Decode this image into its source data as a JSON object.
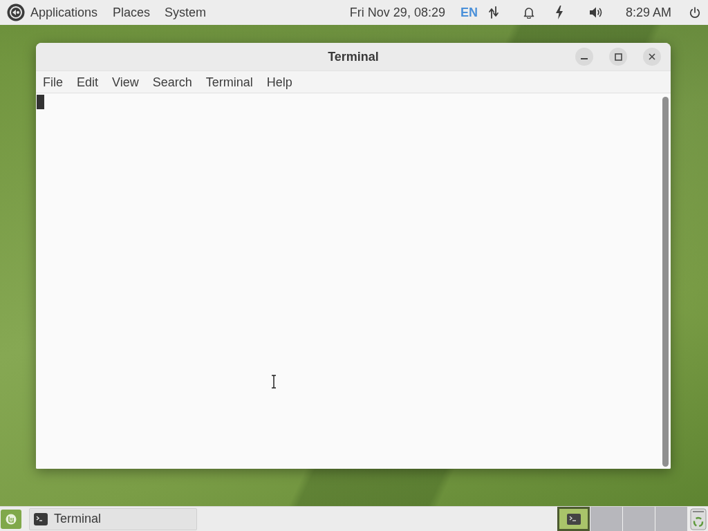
{
  "top_panel": {
    "menus": [
      "Applications",
      "Places",
      "System"
    ],
    "date": "Fri Nov 29, 08:29",
    "keyboard_layout": "EN",
    "clock": "8:29 AM"
  },
  "window": {
    "title": "Terminal",
    "menu": [
      "File",
      "Edit",
      "View",
      "Search",
      "Terminal",
      "Help"
    ]
  },
  "bottom_panel": {
    "tasks": [
      {
        "label": "Terminal"
      }
    ],
    "workspaces": [
      {
        "selected": true
      },
      {
        "selected": false
      },
      {
        "selected": false
      },
      {
        "selected": false
      }
    ]
  }
}
